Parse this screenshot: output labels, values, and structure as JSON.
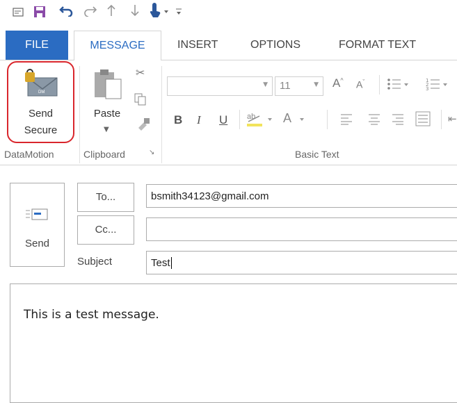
{
  "qat": {
    "icons": [
      "new-item-icon",
      "save-icon",
      "undo-icon",
      "redo-icon",
      "up-arrow-icon",
      "down-arrow-icon",
      "touch-mode-icon",
      "customize-icon"
    ]
  },
  "tabs": [
    {
      "label": "FILE",
      "active": false
    },
    {
      "label": "MESSAGE",
      "active": true
    },
    {
      "label": "INSERT",
      "active": false
    },
    {
      "label": "OPTIONS",
      "active": false
    },
    {
      "label": "FORMAT TEXT",
      "active": false
    }
  ],
  "ribbon": {
    "datamotion": {
      "send_secure_line1": "Send",
      "send_secure_line2": "Secure",
      "group_label": "DataMotion",
      "highlight_color": "#d9262c"
    },
    "clipboard": {
      "paste_label": "Paste",
      "group_label": "Clipboard"
    },
    "basic_text": {
      "font_size": "11",
      "group_label": "Basic Text"
    }
  },
  "compose": {
    "send_label": "Send",
    "to_button": "To...",
    "cc_button": "Cc...",
    "subject_label": "Subject",
    "to_value": "bsmith34123@gmail.com",
    "cc_value": "",
    "subject_value": "Test",
    "body_text": "This is a test message."
  },
  "colors": {
    "accent": "#2b6cc2",
    "file_tab_bg": "#2b6cc2"
  }
}
